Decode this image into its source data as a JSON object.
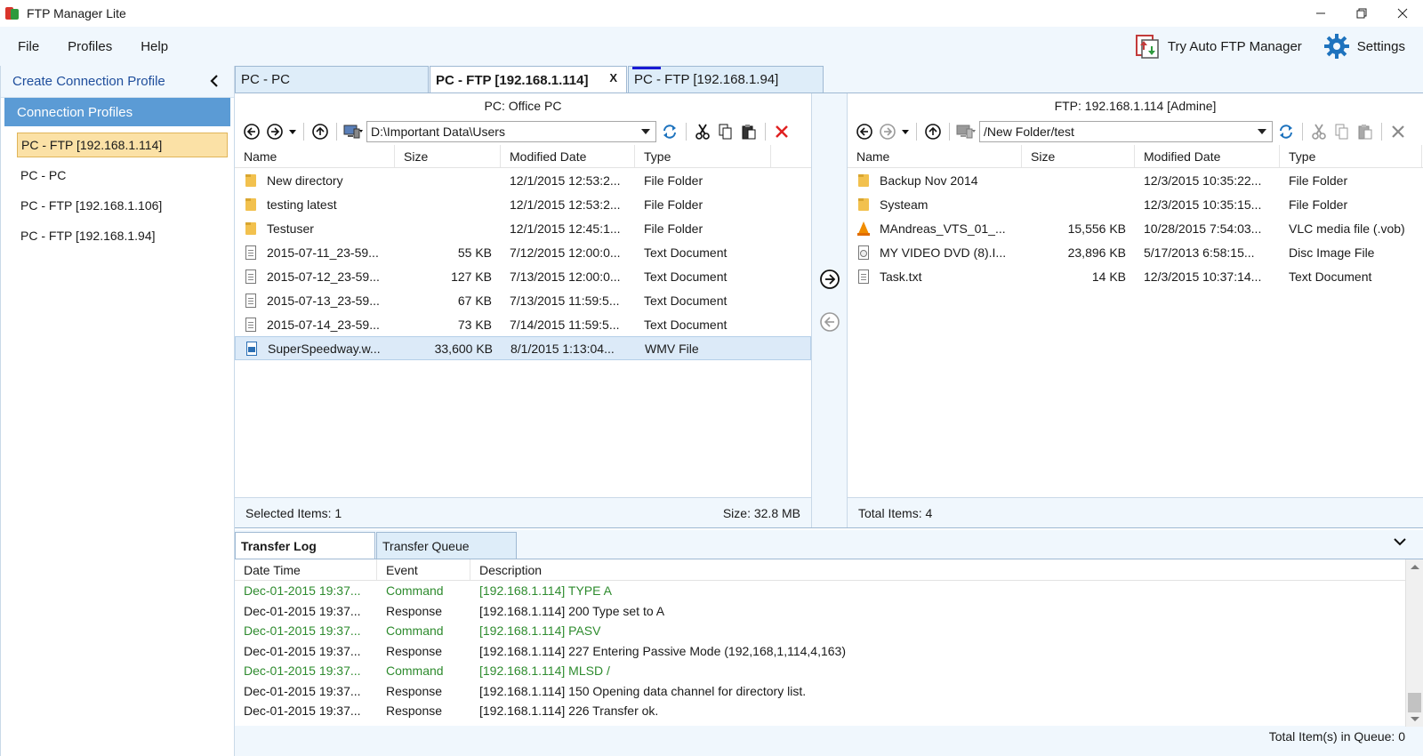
{
  "window": {
    "title": "FTP Manager Lite",
    "minimize": "–",
    "restore": "❐",
    "close": "✕"
  },
  "menu": {
    "items": [
      "File",
      "Profiles",
      "Help"
    ],
    "try_auto": "Try Auto FTP Manager",
    "settings": "Settings"
  },
  "sidebar": {
    "create_profile": "Create Connection Profile",
    "collapse": "‹",
    "profiles_header": "Connection Profiles",
    "items": [
      {
        "label": "PC - FTP [192.168.1.114]",
        "selected": true
      },
      {
        "label": "PC - PC",
        "selected": false
      },
      {
        "label": "PC - FTP [192.168.1.106]",
        "selected": false
      },
      {
        "label": "PC - FTP [192.168.1.94]",
        "selected": false
      }
    ]
  },
  "tabs": [
    {
      "label": "PC - PC",
      "active": false
    },
    {
      "label": "PC - FTP [192.168.1.114]",
      "active": true,
      "close": "X"
    },
    {
      "label": "PC - FTP [192.168.1.94]",
      "active": false
    }
  ],
  "left_panel": {
    "title": "PC: Office PC",
    "path": "D:\\Important Data\\Users",
    "columns": [
      "Name",
      "Size",
      "Modified Date",
      "Type"
    ],
    "rows": [
      {
        "icon": "folder",
        "name": "New directory",
        "size": "",
        "modified": "12/1/2015 12:53:2...",
        "type": "File Folder"
      },
      {
        "icon": "folder",
        "name": "testing latest",
        "size": "",
        "modified": "12/1/2015 12:53:2...",
        "type": "File Folder"
      },
      {
        "icon": "folder",
        "name": "Testuser",
        "size": "",
        "modified": "12/1/2015 12:45:1...",
        "type": "File Folder"
      },
      {
        "icon": "doc",
        "name": "2015-07-11_23-59...",
        "size": "55 KB",
        "modified": "7/12/2015 12:00:0...",
        "type": "Text Document"
      },
      {
        "icon": "doc",
        "name": "2015-07-12_23-59...",
        "size": "127 KB",
        "modified": "7/13/2015 12:00:0...",
        "type": "Text Document"
      },
      {
        "icon": "doc",
        "name": "2015-07-13_23-59...",
        "size": "67 KB",
        "modified": "7/13/2015 11:59:5...",
        "type": "Text Document"
      },
      {
        "icon": "doc",
        "name": "2015-07-14_23-59...",
        "size": "73 KB",
        "modified": "7/14/2015 11:59:5...",
        "type": "Text Document"
      },
      {
        "icon": "video",
        "name": "SuperSpeedway.w...",
        "size": "33,600 KB",
        "modified": "8/1/2015 1:13:04...",
        "type": "WMV File",
        "selected": true
      }
    ],
    "status_left": "Selected Items: 1",
    "status_right": "Size: 32.8 MB"
  },
  "right_panel": {
    "title": "FTP: 192.168.1.114 [Admine]",
    "path": "/New Folder/test",
    "columns": [
      "Name",
      "Size",
      "Modified Date",
      "Type"
    ],
    "rows": [
      {
        "icon": "folder",
        "name": "Backup Nov 2014",
        "size": "",
        "modified": "12/3/2015 10:35:22...",
        "type": "File Folder"
      },
      {
        "icon": "folder",
        "name": "Systeam",
        "size": "",
        "modified": "12/3/2015 10:35:15...",
        "type": "File Folder"
      },
      {
        "icon": "vlc",
        "name": "MAndreas_VTS_01_...",
        "size": "15,556 KB",
        "modified": "10/28/2015 7:54:03...",
        "type": "VLC media file (.vob)"
      },
      {
        "icon": "disc",
        "name": "MY VIDEO DVD (8).I...",
        "size": "23,896 KB",
        "modified": "5/17/2013 6:58:15...",
        "type": "Disc Image File"
      },
      {
        "icon": "doc",
        "name": "Task.txt",
        "size": "14 KB",
        "modified": "12/3/2015 10:37:14...",
        "type": "Text Document"
      }
    ],
    "status_left": "Total Items: 4"
  },
  "log": {
    "tabs": [
      "Transfer Log",
      "Transfer Queue"
    ],
    "columns": [
      "Date Time",
      "Event",
      "Description"
    ],
    "rows": [
      {
        "kind": "command",
        "time": "Dec-01-2015 19:37...",
        "event": "Command",
        "desc": "[192.168.1.114] TYPE A"
      },
      {
        "kind": "response",
        "time": "Dec-01-2015 19:37...",
        "event": "Response",
        "desc": "[192.168.1.114] 200 Type set to A"
      },
      {
        "kind": "command",
        "time": "Dec-01-2015 19:37...",
        "event": "Command",
        "desc": "[192.168.1.114] PASV"
      },
      {
        "kind": "response",
        "time": "Dec-01-2015 19:37...",
        "event": "Response",
        "desc": "[192.168.1.114] 227 Entering Passive Mode (192,168,1,114,4,163)"
      },
      {
        "kind": "command",
        "time": "Dec-01-2015 19:37...",
        "event": "Command",
        "desc": "[192.168.1.114] MLSD /"
      },
      {
        "kind": "response",
        "time": "Dec-01-2015 19:37...",
        "event": "Response",
        "desc": "[192.168.1.114] 150 Opening data channel for directory list."
      },
      {
        "kind": "response",
        "time": "Dec-01-2015 19:37...",
        "event": "Response",
        "desc": "[192.168.1.114] 226 Transfer ok."
      }
    ],
    "queue_status": "Total Item(s) in Queue: 0"
  },
  "colors": {
    "accent": "#5b9bd5",
    "selected_profile": "#fbe1a6",
    "command_text": "#2e8b2e",
    "delete_red": "#e02020"
  }
}
